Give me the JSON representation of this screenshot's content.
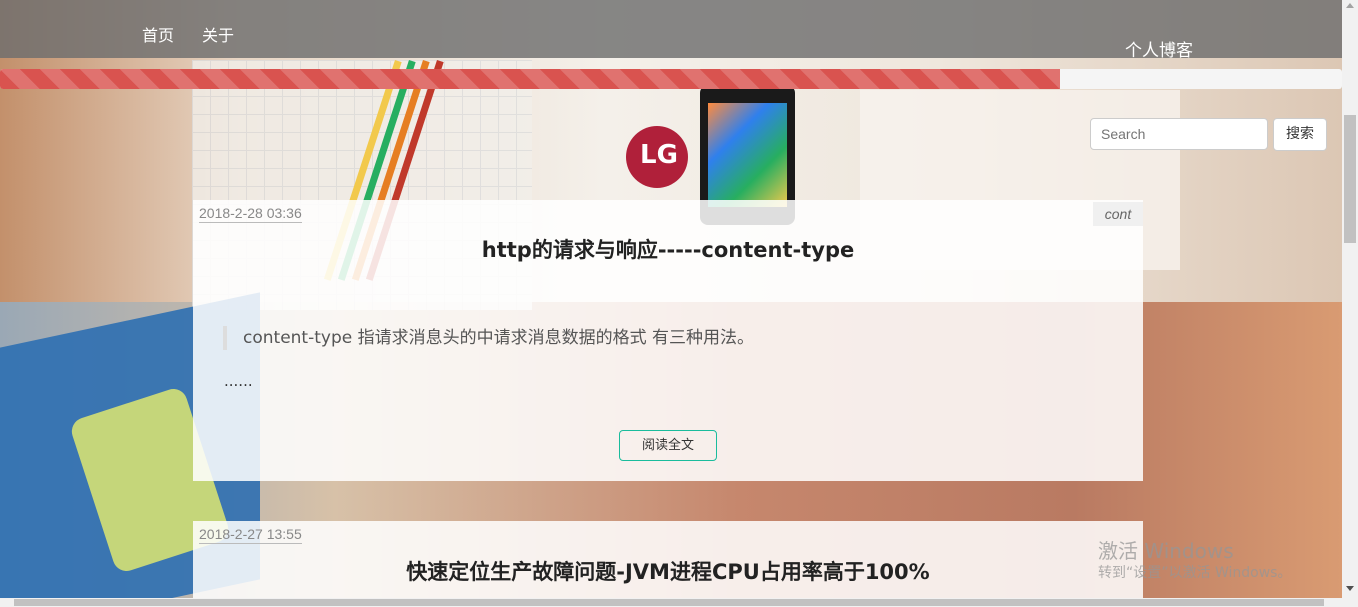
{
  "nav": {
    "links": [
      "首页",
      "关于"
    ],
    "brand": "个人博客"
  },
  "progress": {
    "value_percent": 79,
    "color": "#d9534f"
  },
  "search": {
    "placeholder": "Search",
    "button_label": "搜索"
  },
  "posts": [
    {
      "date": "2018-2-28 03:36",
      "tag": "cont",
      "title": "http的请求与响应-----content-type",
      "summary": "content-type 指请求消息头的中请求消息数据的格式 有三种用法。",
      "ellipsis": "......",
      "read_more": "阅读全文"
    },
    {
      "date": "2018-2-27 13:55",
      "title": "快速定位生产故障问题-JVM进程CPU占用率高于100%"
    }
  ],
  "watermark": {
    "line1": "激活 Windows",
    "line2": "转到“设置”以激活 Windows。"
  },
  "colors": {
    "accent": "#1abc9c",
    "navbar": "#6e6e6e"
  }
}
